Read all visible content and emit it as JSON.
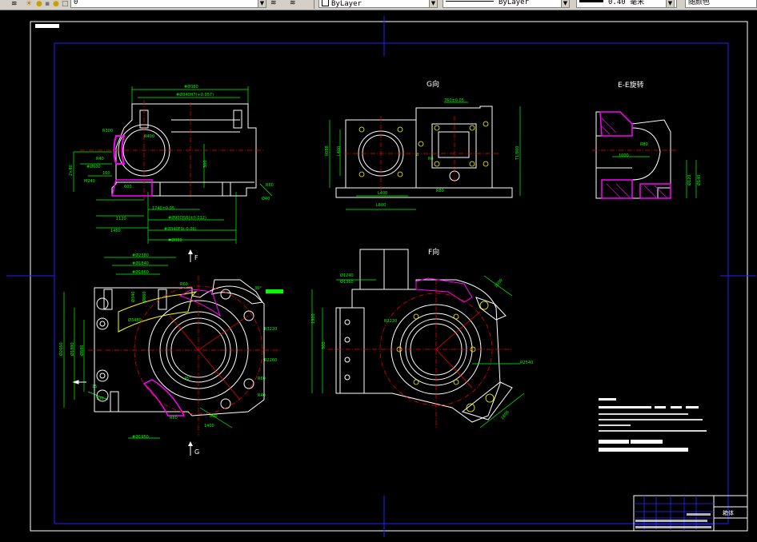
{
  "toolbar": {
    "layer_name": "0",
    "color_combo": "ByLayer",
    "linetype_combo": "ByLayer",
    "lineweight_combo": "0.40 毫米",
    "plotstyle_combo": "随颜色"
  },
  "drawing": {
    "view_g_label": "G向",
    "view_ee_label": "E-E旋转",
    "view_f_label": "F向",
    "arrow_f": "F",
    "arrow_g": "G",
    "title_block_name": "箱体"
  },
  "colors": {
    "background": "#000000",
    "outline": "#ffffff",
    "dimension": "#00ff00",
    "center": "#ff0000",
    "frame": "#0000ff",
    "hatch": "#ff00ff",
    "extension": "#00ffff",
    "highlight": "#ffff00"
  }
}
